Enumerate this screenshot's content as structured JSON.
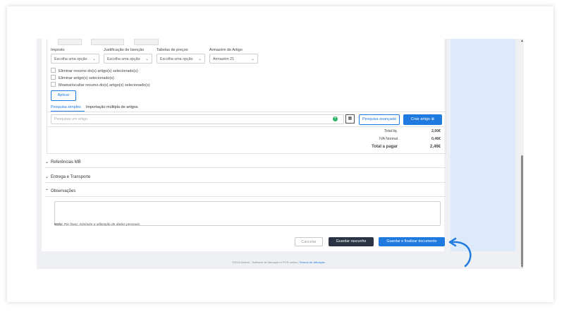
{
  "filters": {
    "imposto": {
      "label": "Imposto",
      "value": "Escolha uma opção"
    },
    "justificacao": {
      "label": "Justificação de Isenção",
      "value": "Escolha uma opção"
    },
    "tabelas": {
      "label": "Tabelas de preços",
      "value": "Escolha uma opção"
    },
    "armazem": {
      "label": "Armazém de Artigo",
      "value": "Armazém 21"
    }
  },
  "checks": [
    "Eliminar resumo do(s) artigo(s) selecionado(s)",
    "Eliminar artigo(s) selecionado(s)",
    "Mostrar/ocultar resumo do(s) artigo(s) selecionado(s)"
  ],
  "apply_label": "Aplicar",
  "tabs": {
    "simple": "Pesquisa simples",
    "import": "Importação múltipla de artigos"
  },
  "search": {
    "placeholder": "Pesquisar um artigo",
    "advanced": "Pesquisa avançada",
    "create": "Criar artigo"
  },
  "totals": {
    "total_liq_label": "Total liq.",
    "total_liq_value": "2,00€",
    "iva_label": "IVA Normal",
    "iva_value": "0,46€",
    "pay_label": "Total a pagar",
    "pay_value": "2,46€"
  },
  "sections": {
    "mb": "Referências MB",
    "delivery": "Entrega e Transporte",
    "obs": "Observações"
  },
  "note": {
    "bold": "Nota:",
    "text": " Por favor, minimize a utilização de dados pessoais."
  },
  "actions": {
    "cancel": "Cancelar",
    "draft": "Guardar rascunho",
    "finalize": "Guardar e finalizar documento"
  },
  "footer": {
    "text": "©2024 Moloni - Software de faturação e POS online | ",
    "link": "Termos de utilização"
  },
  "colors": {
    "accent": "#1f7ae0",
    "dark": "#2b3444"
  }
}
